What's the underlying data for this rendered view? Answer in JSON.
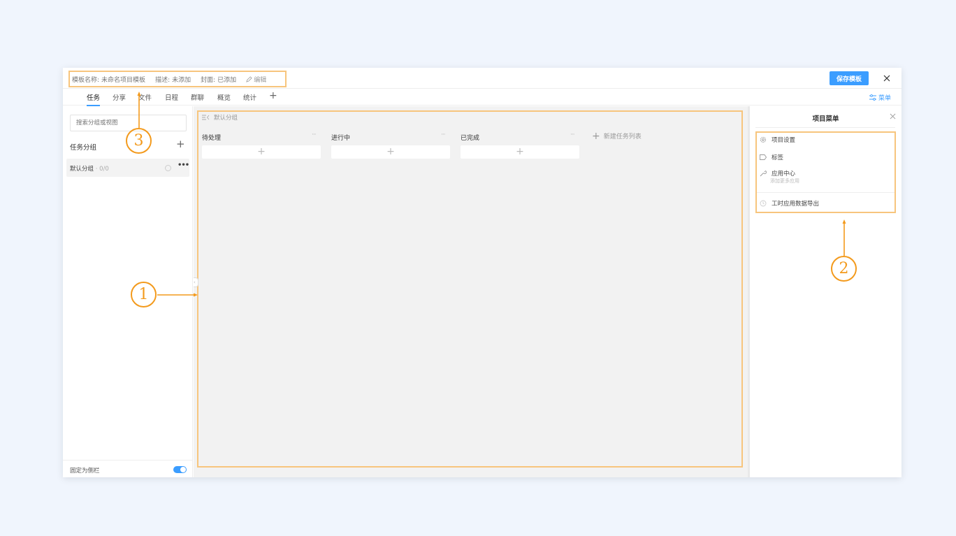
{
  "header": {
    "meta": {
      "name_label": "模板名称:",
      "name_value": "未命名项目模板",
      "desc_label": "描述:",
      "desc_value": "未添加",
      "cover_label": "封面:",
      "cover_value": "已添加",
      "edit_label": "编辑"
    },
    "save_label": "保存模板",
    "close_icon": "close-icon"
  },
  "tabs": [
    {
      "label": "任务",
      "active": true
    },
    {
      "label": "分享"
    },
    {
      "label": "文件"
    },
    {
      "label": "日程"
    },
    {
      "label": "群聊"
    },
    {
      "label": "概览"
    },
    {
      "label": "统计"
    }
  ],
  "menu_link": "菜单",
  "sidebar": {
    "search_placeholder": "搜索分组或视图",
    "group_title": "任务分组",
    "group_item": {
      "name": "默认分组",
      "count": "· 0/0"
    },
    "pin_label": "固定为侧栏",
    "pin_on": true
  },
  "board": {
    "group_name": "默认分组",
    "columns": [
      {
        "title": "待处理"
      },
      {
        "title": "进行中"
      },
      {
        "title": "已完成"
      }
    ],
    "new_list": "新建任务列表"
  },
  "right_panel": {
    "title": "项目菜单",
    "items": [
      {
        "label": "项目设置",
        "icon": "gear-icon"
      },
      {
        "label": "标签",
        "icon": "tag-icon"
      },
      {
        "label": "应用中心",
        "icon": "wrench-icon",
        "sub": "添加更多应用"
      },
      {
        "label": "工时应用数据导出",
        "icon": "clock-icon"
      }
    ]
  },
  "annotations": [
    "1",
    "2",
    "3"
  ],
  "colors": {
    "accent": "#3b9dff",
    "annotation": "#f39a1c",
    "highlight_box": "#f7c57d",
    "page_bg": "#f0f5fd"
  }
}
